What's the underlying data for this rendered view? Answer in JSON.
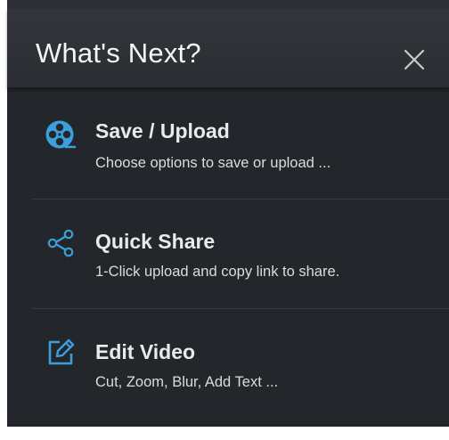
{
  "dialog": {
    "title": "What's Next?",
    "close_icon": "close-icon"
  },
  "options": [
    {
      "icon": "film-reel-icon",
      "label": "Save / Upload",
      "description": "Choose options to save or upload ..."
    },
    {
      "icon": "share-icon",
      "label": "Quick Share",
      "description": "1-Click upload and copy link to share."
    },
    {
      "icon": "edit-icon",
      "label": "Edit Video",
      "description": "Cut, Zoom, Blur, Add Text ..."
    }
  ],
  "colors": {
    "accent": "#3aa0dc",
    "background": "#23262b",
    "header": "#2f3237"
  }
}
